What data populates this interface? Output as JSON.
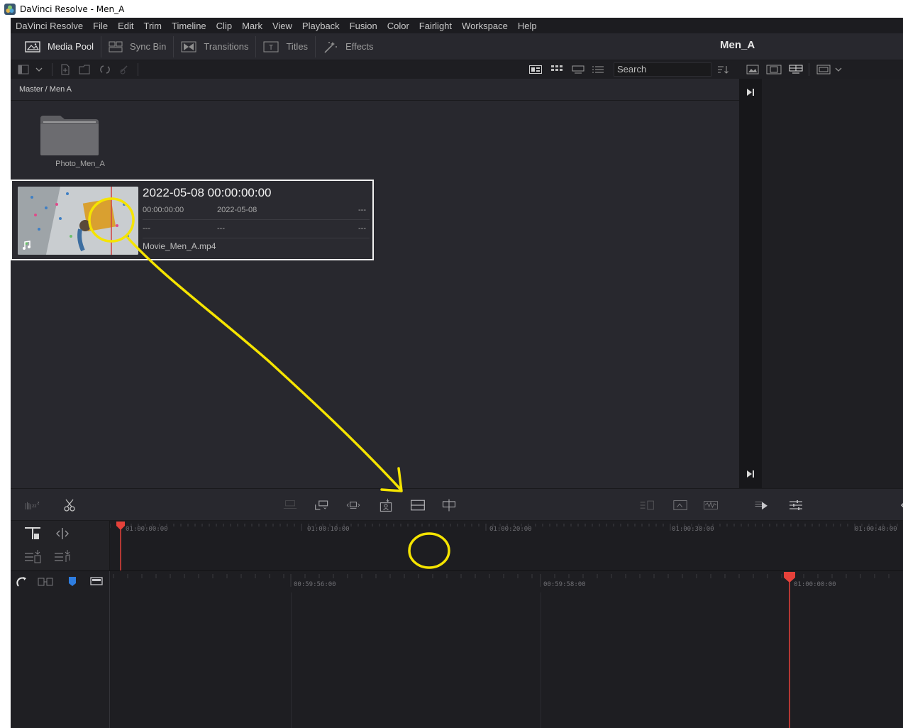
{
  "window": {
    "title": "DaVinci Resolve - Men_A"
  },
  "menu": [
    "DaVinci Resolve",
    "File",
    "Edit",
    "Trim",
    "Timeline",
    "Clip",
    "Mark",
    "View",
    "Playback",
    "Fusion",
    "Color",
    "Fairlight",
    "Workspace",
    "Help"
  ],
  "toolbar": {
    "media_pool": "Media Pool",
    "sync_bin": "Sync Bin",
    "transitions": "Transitions",
    "titles": "Titles",
    "effects": "Effects"
  },
  "project": {
    "name": "Men_A"
  },
  "search": {
    "placeholder": "Search"
  },
  "breadcrumb": "Master / Men A",
  "folder": {
    "name": "Photo_Men_A"
  },
  "clip": {
    "title": "2022-05-08  00:00:00:00",
    "timecode": "00:00:00:00",
    "date": "2022-05-08",
    "dash1": "---",
    "dash2": "---",
    "dash3": "---",
    "dash4": "---",
    "filename": "Movie_Men_A.mp4"
  },
  "timeline_upper": {
    "ticks": [
      "01:00:00:00",
      "01:00:10:00",
      "01:00:20:00",
      "01:00:30:00",
      "01:00:40:00"
    ]
  },
  "timeline_lower": {
    "ticks": [
      "00:59:56:00",
      "00:59:58:00",
      "01:00:00:00"
    ]
  },
  "colors": {
    "accent_playhead": "#e5413a",
    "annotation": "#f5e400",
    "flag_blue": "#2e7de0"
  }
}
